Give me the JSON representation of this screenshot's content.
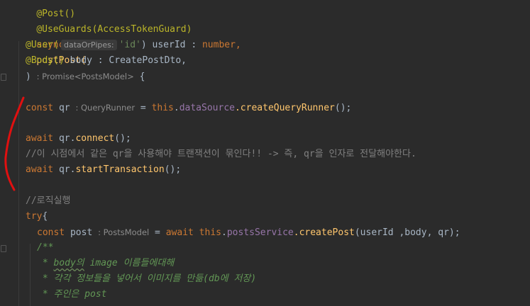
{
  "code": {
    "l0": "@Post()",
    "l1": "@UseGuards(AccessTokenGuard)",
    "l2_kw": "async",
    "l2_fn": "postPost(",
    "l3_ann": "@User(",
    "l3_hint": "dataOrPipes:",
    "l3_str": "'id'",
    "l3_rest": ") userId : ",
    "l3_type": "number,",
    "l4_ann": "@Body()",
    "l4_rest": " body : CreatePostDto,",
    "l5_open": ") ",
    "l5_hint": ": Promise<PostsModel>",
    "l5_close": " {",
    "l6_kw": "const",
    "l6_var": " qr ",
    "l6_hint": ": QueryRunner",
    "l6_eq": " = ",
    "l6_this": "this",
    "l6_dot": ".",
    "l6_field": "dataSource",
    "l6_call": ".createQueryRunner",
    "l6_end": "();",
    "l7_kw": "await",
    "l7_obj": " qr.",
    "l7_fn": "connect",
    "l7_end": "();",
    "l8_comment": "//이 시점에서 같은 qr을 사용해야 트랜잭션이 묶인다!! -> 즉, qr을 인자로 전달해야한다.",
    "l9_kw": "await",
    "l9_obj": " qr.",
    "l9_fn": "startTransaction",
    "l9_end": "();",
    "l10_comment": "//로직실행",
    "l11_kw": "try",
    "l11_brace": "{",
    "l12_kw": "const",
    "l12_var": " post ",
    "l12_hint": ": PostsModel",
    "l12_eq": " = ",
    "l12_await": "await",
    "l12_this": " this",
    "l12_dot": ".",
    "l12_field": "postsService",
    "l12_call": ".createPost",
    "l12_args": "(userId ,body, qr);",
    "l13_doc": "/**",
    "l14_star": " * ",
    "l14_a": "body의",
    "l14_b": " image 이름들에대해",
    "l15_doc": " * 각각 정보들을 넣어서 이미지를 만듦(db에 저장)",
    "l16_doc": " * 주인은 post"
  },
  "colors": {
    "background": "#2b2b2b",
    "annotation": "#bbb529",
    "keyword": "#cc7832",
    "function": "#ffc66d",
    "string": "#6a8759",
    "field": "#9876aa",
    "comment": "#808080",
    "doc_comment": "#629755",
    "pen_marker": "#e01010"
  }
}
